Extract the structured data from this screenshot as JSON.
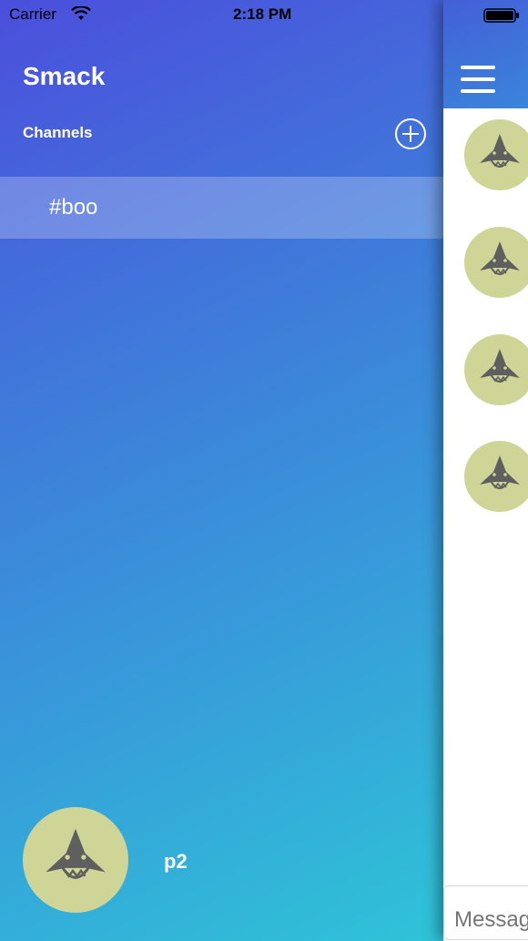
{
  "status_bar": {
    "carrier": "Carrier",
    "time": "2:18 PM"
  },
  "sidebar": {
    "app_title": "Smack",
    "channels_label": "Channels",
    "channels": [
      {
        "label": "#boo"
      }
    ],
    "user": {
      "name": "p2"
    }
  },
  "chat": {
    "message_placeholder": "Message"
  },
  "colors": {
    "gradient_top": "#4b4fdc",
    "gradient_bottom": "#2ec7d8",
    "avatar_bg": "#cfd597",
    "shark_fill": "#5f5f5f"
  },
  "icons": {
    "add": "plus-circle-icon",
    "menu": "hamburger-menu-icon",
    "avatar": "shark-avatar"
  }
}
